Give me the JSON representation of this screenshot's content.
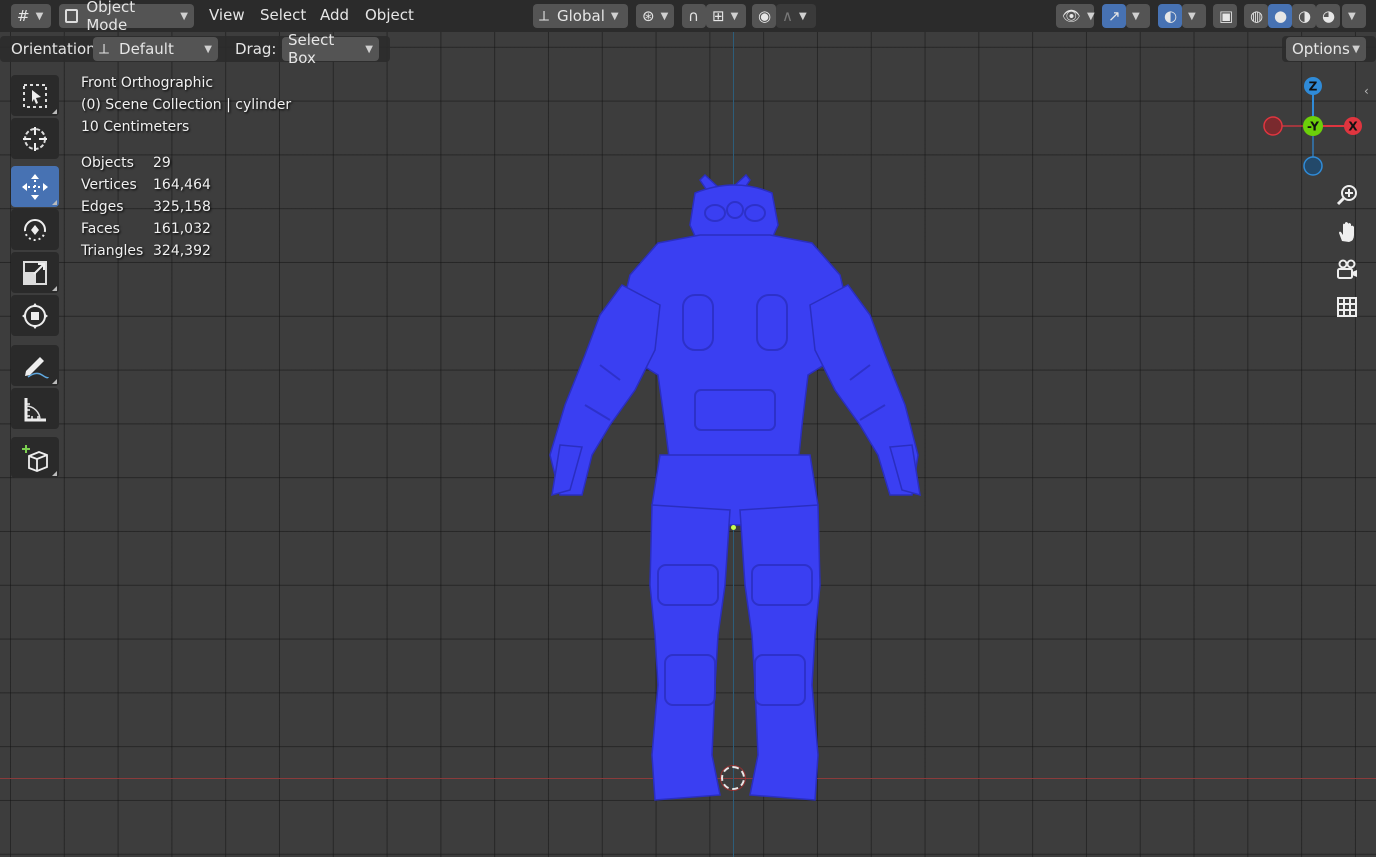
{
  "header": {
    "editor_type_icon": "viewport-editor-icon",
    "mode": "Object Mode",
    "menus": [
      "View",
      "Select",
      "Add",
      "Object"
    ],
    "transform_orientation": "Global",
    "options_label": "Options"
  },
  "tool_header": {
    "orientation_label": "Orientation:",
    "orientation_value": "Default",
    "drag_label": "Drag:",
    "drag_value": "Select Box"
  },
  "overlay": {
    "view_name": "Front Orthographic",
    "collection": "(0) Scene Collection | cylinder",
    "scale": "10 Centimeters",
    "stats": [
      {
        "label": "Objects",
        "value": "29"
      },
      {
        "label": "Vertices",
        "value": "164,464"
      },
      {
        "label": "Edges",
        "value": "325,158"
      },
      {
        "label": "Faces",
        "value": "161,032"
      },
      {
        "label": "Triangles",
        "value": "324,392"
      }
    ]
  },
  "gizmo": {
    "z_label": "Z",
    "y_label": "-Y",
    "x_label": "X",
    "x_color": "#e0353f",
    "y_color": "#6cd00a",
    "z_color": "#2f8bd8"
  },
  "colors": {
    "accent": "#4772b3",
    "model": "#3a3ff2"
  }
}
